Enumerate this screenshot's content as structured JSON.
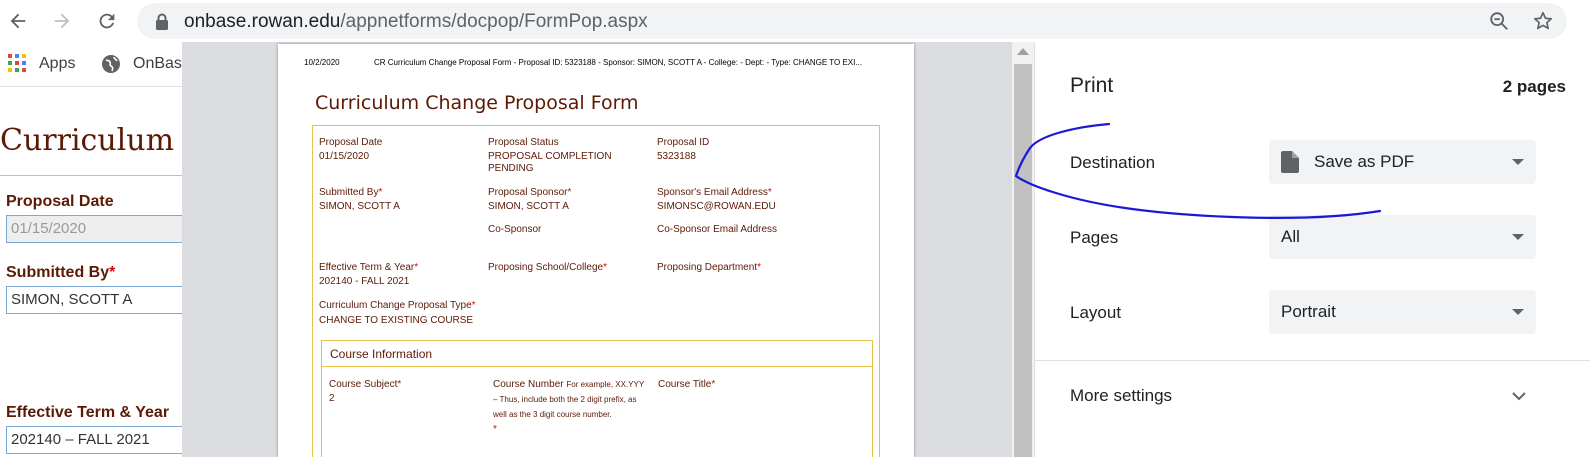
{
  "browser": {
    "url_host": "onbase.rowan.edu",
    "url_path": "/appnetforms/docpop/FormPop.aspx"
  },
  "bookmarks": [
    {
      "label": "Apps"
    },
    {
      "label": "OnBas"
    }
  ],
  "background_page": {
    "title": "Curriculum",
    "proposal_date_label": "Proposal Date",
    "proposal_date_value": "01/15/2020",
    "submitted_by_label": "Submitted By",
    "submitted_by_value": "SIMON, SCOTT A",
    "effective_term_label": "Effective Term & Year",
    "effective_term_value": "202140 – FALL 2021",
    "required_mark": "*"
  },
  "preview": {
    "header_date": "10/2/2020",
    "header_text": "CR Curriculum Change Proposal Form - Proposal ID: 5323188 - Sponsor: SIMON, SCOTT A - College: - Dept: - Type: CHANGE TO EXI...",
    "form_title": "Curriculum Change Proposal Form",
    "required_mark": "*",
    "fields": {
      "proposal_date_label": "Proposal Date",
      "proposal_date_value": "01/15/2020",
      "proposal_status_label": "Proposal Status",
      "proposal_status_value_1": "PROPOSAL COMPLETION",
      "proposal_status_value_2": "PENDING",
      "proposal_id_label": "Proposal ID",
      "proposal_id_value": "5323188",
      "submitted_by_label": "Submitted By",
      "submitted_by_value": "SIMON, SCOTT A",
      "proposal_sponsor_label": "Proposal Sponsor",
      "proposal_sponsor_value": "SIMON, SCOTT A",
      "sponsor_email_label": "Sponsor's Email Address",
      "sponsor_email_value": "SIMONSC@ROWAN.EDU",
      "co_sponsor_label": "Co-Sponsor",
      "co_sponsor_email_label": "Co-Sponsor Email Address",
      "effective_term_label": "Effective Term & Year",
      "effective_term_value": "202140 - FALL 2021",
      "proposing_school_label": "Proposing School/College",
      "proposing_dept_label": "Proposing Department",
      "change_type_label": "Curriculum Change Proposal Type",
      "change_type_value": "CHANGE TO EXISTING COURSE"
    },
    "course_info": {
      "header": "Course Information",
      "subject_label": "Course Subject",
      "subject_value": "2",
      "number_label": "Course Number",
      "number_hint_1": "For example, XX.YYY",
      "number_hint_2": "– Thus, include both the 2 digit prefix, as",
      "number_hint_3": "well as the 3 digit course number.",
      "title_label": "Course Title"
    }
  },
  "print_panel": {
    "title": "Print",
    "page_count": "2 pages",
    "destination_label": "Destination",
    "destination_value": "Save as PDF",
    "pages_label": "Pages",
    "pages_value": "All",
    "layout_label": "Layout",
    "layout_value": "Portrait",
    "more_settings_label": "More settings"
  },
  "colors": {
    "form_maroon": "#5c1a05",
    "form_border": "#e6c04a",
    "annotation_ink": "#1a1ad6"
  }
}
